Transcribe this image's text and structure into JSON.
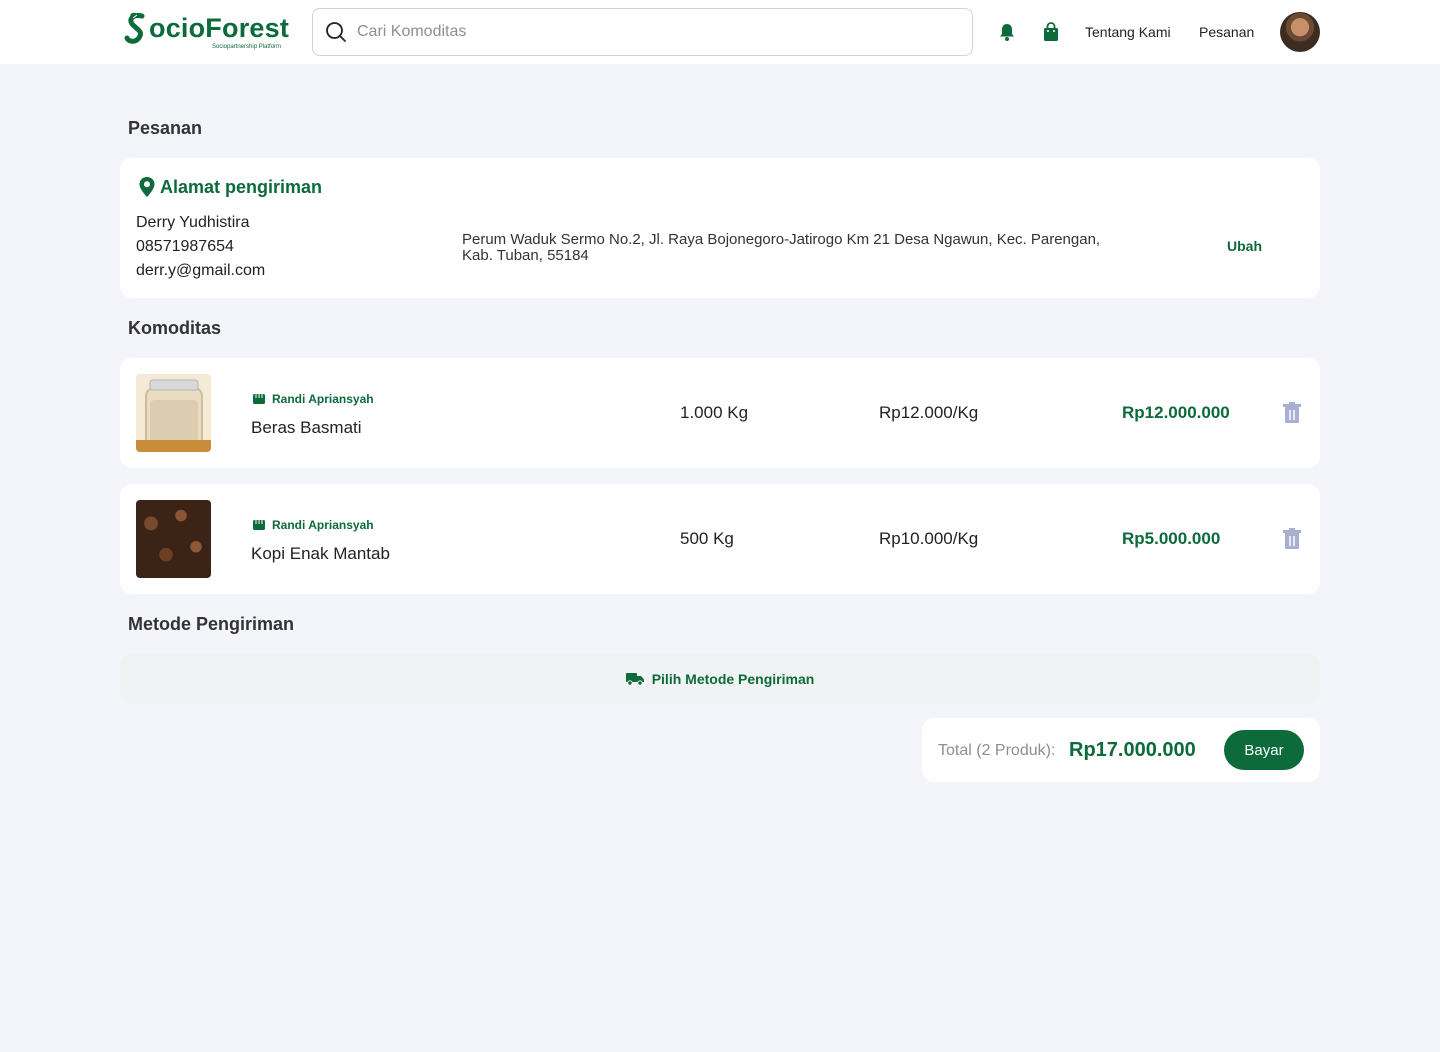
{
  "header": {
    "logo_text": "ocioForest",
    "logo_tagline": "Sociopartnership Platform",
    "search_placeholder": "Cari Komoditas",
    "nav": [
      "Tentang Kami",
      "Pesanan"
    ]
  },
  "page_title": "Pesanan",
  "address": {
    "title": "Alamat pengiriman",
    "name": "Derry Yudhistira",
    "phone": "08571987654",
    "email": "derr.y@gmail.com",
    "full_line1": "Perum Waduk Sermo No.2, Jl. Raya Bojonegoro-Jatirogo Km 21 Desa Ngawun, Kec. Parengan,",
    "full_line2": "Kab. Tuban, 55184",
    "edit_label": "Ubah"
  },
  "commodities_title": "Komoditas",
  "items": [
    {
      "seller": "Randi Apriansyah",
      "name": "Beras Basmati",
      "qty": "1.000 Kg",
      "unit_price": "Rp12.000/Kg",
      "subtotal": "Rp12.000.000"
    },
    {
      "seller": "Randi Apriansyah",
      "name": "Kopi Enak Mantab",
      "qty": "500 Kg",
      "unit_price": "Rp10.000/Kg",
      "subtotal": "Rp5.000.000"
    }
  ],
  "shipping": {
    "title": "Metode Pengiriman",
    "choose_label": "Pilih Metode Pengiriman"
  },
  "total": {
    "label": "Total (2 Produk):",
    "value": "Rp17.000.000",
    "pay_label": "Bayar"
  },
  "colors": {
    "brand": "#0d6a3b",
    "background": "#f4f5fb",
    "trash": "#a9aed3"
  }
}
